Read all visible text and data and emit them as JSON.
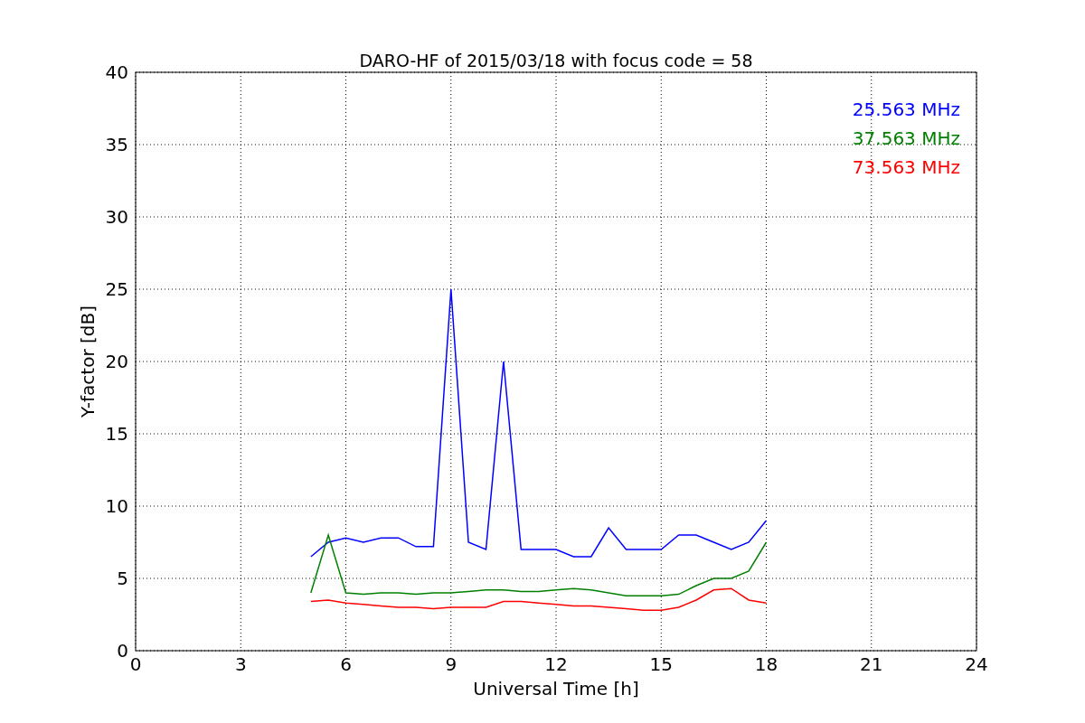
{
  "chart_data": {
    "type": "line",
    "title": "DARO-HF of 2015/03/18 with focus code = 58",
    "xlabel": "Universal Time [h]",
    "ylabel": "Y-factor [dB]",
    "x": [
      5,
      5.5,
      6,
      6.5,
      7,
      7.5,
      8,
      8.5,
      9,
      9.5,
      10,
      10.5,
      11,
      11.5,
      12,
      12.5,
      13,
      13.5,
      14,
      14.5,
      15,
      15.5,
      16,
      16.5,
      17,
      17.5,
      18
    ],
    "series": [
      {
        "name": "25.563 MHz",
        "color": "#0000ff",
        "values": [
          6.5,
          7.5,
          7.8,
          7.5,
          7.8,
          7.8,
          7.2,
          7.2,
          25,
          7.5,
          7,
          20,
          7,
          7,
          7,
          6.5,
          6.5,
          8.5,
          7,
          7,
          7,
          8,
          8,
          7.5,
          7,
          7.5,
          9
        ]
      },
      {
        "name": "37.563 MHz",
        "color": "#008000",
        "values": [
          4,
          8,
          4,
          3.9,
          4,
          4,
          3.9,
          4,
          4,
          4.1,
          4.2,
          4.2,
          4.1,
          4.1,
          4.2,
          4.3,
          4.2,
          4,
          3.8,
          3.8,
          3.8,
          3.9,
          4.5,
          5,
          5,
          5.5,
          7.5
        ]
      },
      {
        "name": "73.563 MHz",
        "color": "#ff0000",
        "values": [
          3.4,
          3.5,
          3.3,
          3.2,
          3.1,
          3.0,
          3.0,
          2.9,
          3.0,
          3.0,
          3.0,
          3.4,
          3.4,
          3.3,
          3.2,
          3.1,
          3.1,
          3.0,
          2.9,
          2.8,
          2.8,
          3.0,
          3.5,
          4.2,
          4.3,
          3.5,
          3.3
        ]
      }
    ],
    "xlim": [
      0,
      24
    ],
    "ylim": [
      0,
      40
    ],
    "xticks": [
      0,
      3,
      6,
      9,
      12,
      15,
      18,
      21,
      24
    ],
    "yticks": [
      0,
      5,
      10,
      15,
      20,
      25,
      30,
      35,
      40
    ],
    "grid": true
  }
}
